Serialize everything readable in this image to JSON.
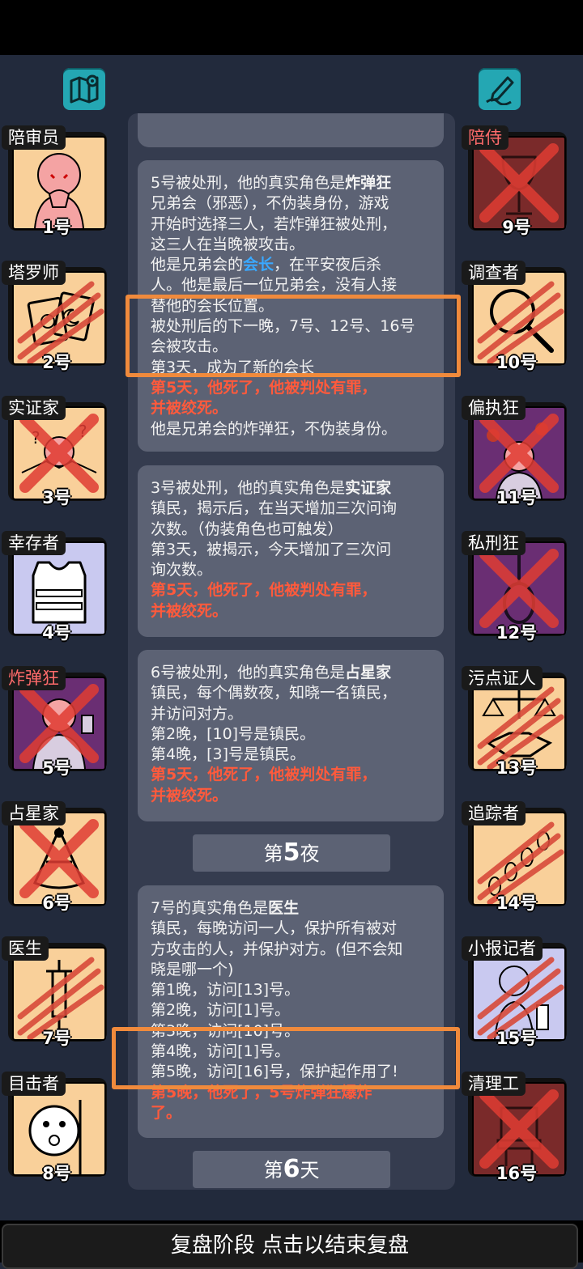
{
  "players": [
    {
      "num": "1号",
      "role": "陪审员"
    },
    {
      "num": "2号",
      "role": "塔罗师"
    },
    {
      "num": "3号",
      "role": "实证家"
    },
    {
      "num": "4号",
      "role": "幸存者"
    },
    {
      "num": "5号",
      "role": "炸弹狂"
    },
    {
      "num": "6号",
      "role": "占星家"
    },
    {
      "num": "7号",
      "role": "医生"
    },
    {
      "num": "8号",
      "role": "目击者"
    },
    {
      "num": "9号",
      "role": "陪侍"
    },
    {
      "num": "10号",
      "role": "调查者"
    },
    {
      "num": "11号",
      "role": "偏执狂"
    },
    {
      "num": "12号",
      "role": "私刑狂"
    },
    {
      "num": "13号",
      "role": "污点证人"
    },
    {
      "num": "14号",
      "role": "追踪者"
    },
    {
      "num": "15号",
      "role": "小报记者"
    },
    {
      "num": "16号",
      "role": "清理工"
    }
  ],
  "log": {
    "e1": {
      "l1a": "5号被处刑，他的真实角色是",
      "l1b": "炸弹狂",
      "l2": "兄弟会（邪恶），不伪装身份，游戏",
      "l3": "开始时选择三人，若炸弹狂被处刑，",
      "l4": "这三人在当晚被攻击。",
      "l5a": "他是兄弟会的",
      "l5b": "会长",
      "l5c": "，在平安夜后杀",
      "l6": "人。他是最后一位兄弟会，没有人接",
      "l7": "替他的会长位置。",
      "l8": "被处刑后的下一晚，7号、12号、16号",
      "l9": "会被攻击。",
      "l10": "第3天，成为了新的会长",
      "l11": "第5天，他死了，他被判处有罪，",
      "l12": "并被绞死。",
      "l13": "他是兄弟会的炸弹狂，不伪装身份。"
    },
    "e2": {
      "l1a": "3号被处刑，他的真实角色是",
      "l1b": "实证家",
      "l2": "镇民，揭示后，在当天增加三次问询",
      "l3": "次数。（伪装角色也可触发）",
      "l4": "第3天，被揭示，今天增加了三次问",
      "l5": "询次数。",
      "l6": "第5天，他死了，他被判处有罪，",
      "l7": "并被绞死。"
    },
    "e3": {
      "l1a": "6号被处刑，他的真实角色是",
      "l1b": "占星家",
      "l2": "镇民，每个偶数夜，知晓一名镇民，",
      "l3": "并访问对方。",
      "l4": "第2晚，[10]号是镇民。",
      "l5": "第4晚，[3]号是镇民。",
      "l6": "第5天，他死了，他被判处有罪，",
      "l7": "并被绞死。"
    },
    "night5_prefix": "第",
    "night5_num": "5",
    "night5_suffix": "夜",
    "e4": {
      "l1a": "7号的真实角色是",
      "l1b": "医生",
      "l2": "镇民，每晚访问一人，保护所有被对",
      "l3": "方攻击的人，并保护对方。(但不会知",
      "l4": "晓是哪一个)",
      "l5": "第1晚，访问[13]号。",
      "l6": "第2晚，访问[1]号。",
      "l7": "第3晚，访问[10]号。",
      "l8": "第4晚，访问[1]号。",
      "l9": "第5晚，访问[16]号，保护起作用了!",
      "l10": "第5晚，他死了，5号炸弹狂爆炸",
      "l11": "了。"
    },
    "day6_prefix": "第",
    "day6_num": "6",
    "day6_suffix": "天"
  },
  "bottom_label": "复盘阶段 点击以结束复盘",
  "icons": {
    "left": "map-pin-icon",
    "right": "pen-sign-icon"
  },
  "colors": {
    "accent": "#24a7b3",
    "highlight_box": "#f08a3c",
    "death_text": "#ff5a3c",
    "leader_text": "#3aa8ff"
  }
}
